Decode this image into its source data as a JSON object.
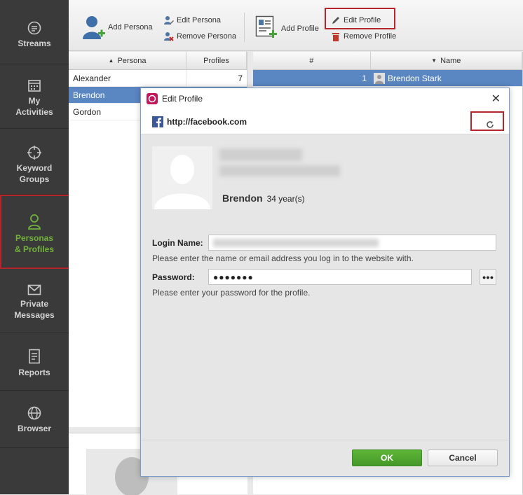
{
  "nav": {
    "items": [
      {
        "label": "Streams",
        "icon": "streams-icon"
      },
      {
        "label": "My Activities",
        "icon": "calendar-icon"
      },
      {
        "label": "Keyword Groups",
        "icon": "target-icon"
      },
      {
        "label": "Personas & Profiles",
        "icon": "person-icon"
      },
      {
        "label": "Private Messages",
        "icon": "envelope-icon"
      },
      {
        "label": "Reports",
        "icon": "reports-icon"
      },
      {
        "label": "Browser",
        "icon": "globe-icon"
      }
    ],
    "active_index": 3
  },
  "toolbar": {
    "add_persona": "Add Persona",
    "edit_persona": "Edit Persona",
    "remove_persona": "Remove Persona",
    "add_profile": "Add Profile",
    "edit_profile": "Edit Profile",
    "remove_profile": "Remove Profile"
  },
  "persona_grid": {
    "columns": [
      "Persona",
      "Profiles"
    ],
    "rows": [
      {
        "name": "Alexander",
        "profiles": "7"
      },
      {
        "name": "Brendon",
        "profiles": ""
      },
      {
        "name": "Gordon",
        "profiles": ""
      }
    ],
    "selected_index": 1
  },
  "profile_grid": {
    "columns": [
      "#",
      "Name"
    ],
    "rows": [
      {
        "num": "1",
        "name": "Brendon Stark"
      }
    ]
  },
  "dialog": {
    "title": "Edit Profile",
    "url": "http://facebook.com",
    "persona_name": "Brendon",
    "persona_age": "34 year(s)",
    "login_label": "Login Name:",
    "login_hint": "Please enter the name or email address you log in to the website with.",
    "password_label": "Password:",
    "password_value": "●●●●●●●",
    "password_hint": "Please enter your password for the profile.",
    "reveal_label": "●●●",
    "ok_label": "OK",
    "cancel_label": "Cancel"
  },
  "colors": {
    "accent_green": "#72b23c",
    "highlight_red": "#b3262d",
    "selection_blue": "#5a86c2",
    "ok_green": "#4f9e2f"
  }
}
